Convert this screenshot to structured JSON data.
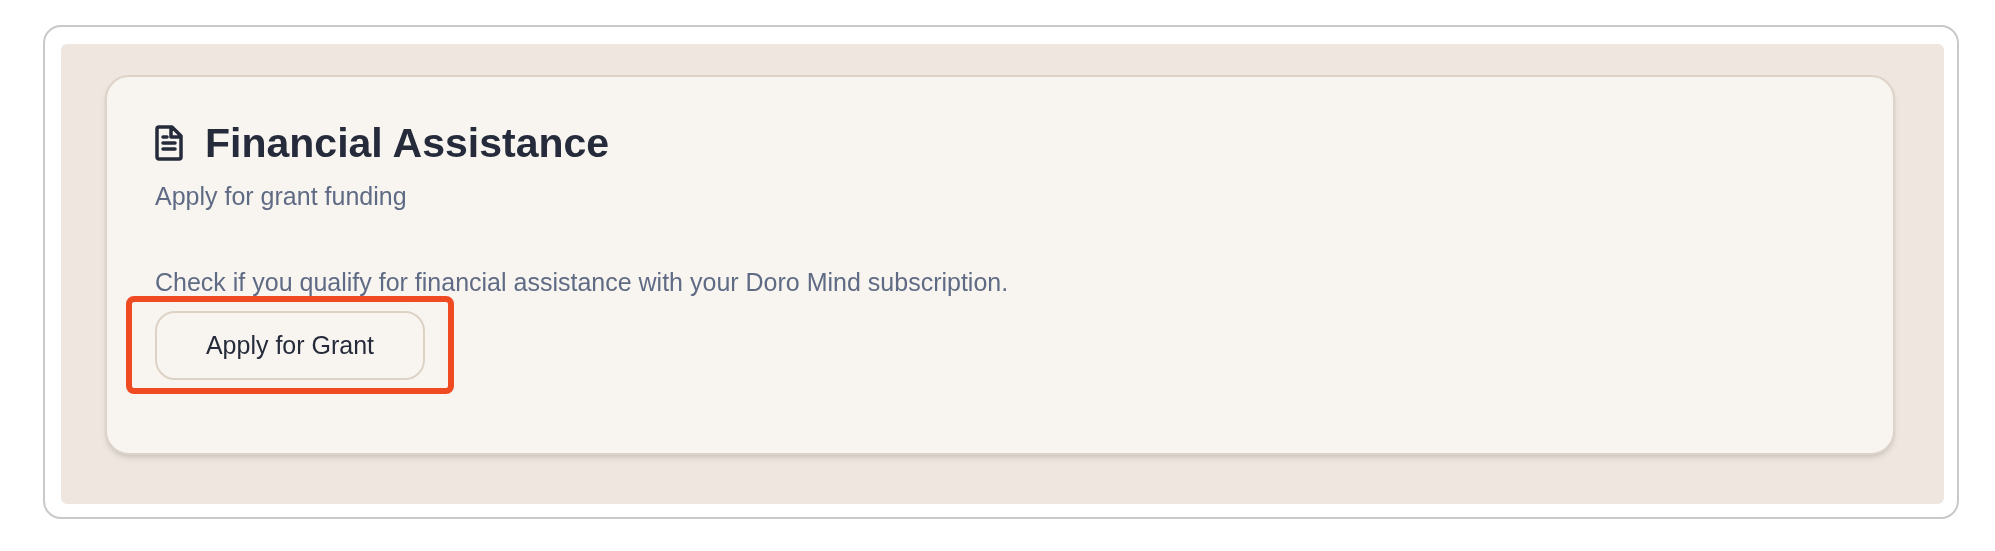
{
  "card": {
    "title": "Financial Assistance",
    "subtitle": "Apply for grant funding",
    "description": "Check if you qualify for financial assistance with your Doro Mind subscription.",
    "button": {
      "label": "Apply for Grant",
      "highlighted": true
    }
  }
}
